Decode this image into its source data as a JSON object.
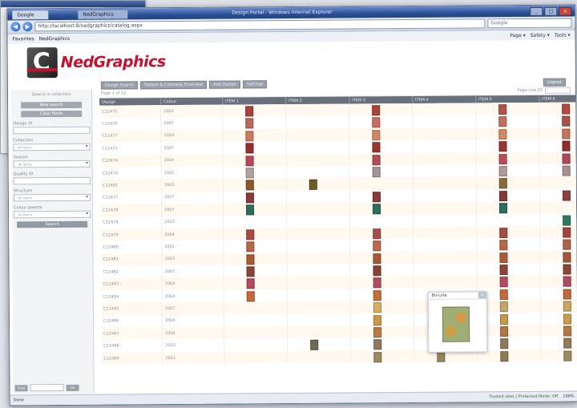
{
  "browser": {
    "tabs": [
      "Google",
      "NedGraphics"
    ],
    "window_title": "Design Portal - Windows Internet Explorer",
    "address": "http://localhost:8/nedgraphics/catalog.aspx",
    "search_placeholder": "Google",
    "favorites_label": "Favorites",
    "fav_item": "NedGraphics",
    "toolbar_right": [
      "Page ▾",
      "Safety ▾",
      "Tools ▾"
    ],
    "window_controls": [
      "_",
      "□",
      "×"
    ]
  },
  "app": {
    "logo_letter": "C",
    "brand": "NedGraphics",
    "brand_color": "#c8102e",
    "top_tabs": [
      "Design Search",
      "Pattern & Colorway Overview",
      "Add Design",
      "Settings"
    ],
    "top_tab_right": "Logout"
  },
  "sidebar": {
    "title": "Search in collection",
    "buttons": [
      "New search",
      "Clear fields"
    ],
    "fields": [
      {
        "label": "Design ID",
        "type": "input"
      },
      {
        "label": "Collection",
        "type": "select",
        "value": "- All items -"
      },
      {
        "label": "Season",
        "type": "select",
        "value": "- All items -"
      },
      {
        "label": "Quality ID",
        "type": "input"
      },
      {
        "label": "Structure",
        "type": "select",
        "value": "- All items -"
      },
      {
        "label": "Colour palette",
        "type": "select",
        "value": "- All items -"
      }
    ],
    "search_button": "Search",
    "bottom_left": "Save",
    "bottom_right": "Go"
  },
  "grid": {
    "toolbar_left": "Page 1 of 12",
    "toolbar_mid": "Page size 25",
    "columns": [
      "Design",
      "Colour",
      "ITEM 1",
      "ITEM 2",
      "ITEM 3",
      "ITEM 4",
      "ITEM 5",
      "ITEM 6"
    ],
    "rows": [
      {
        "design": "C12475",
        "colour": "2003",
        "sw": [
          [
            "#a8423a",
            0
          ],
          [
            "#a8423a",
            2
          ],
          [
            "#b0534a",
            4
          ],
          [
            "#b04a42",
            5
          ]
        ]
      },
      {
        "design": "C12476",
        "colour": "2007",
        "sw": [
          [
            "#b86a58",
            0
          ],
          [
            "#c47060",
            2
          ],
          [
            "#c0705e",
            4
          ],
          [
            "#a8504a",
            5
          ]
        ]
      },
      {
        "design": "C12477",
        "colour": "2003",
        "sw": [
          [
            "#cc7a5a",
            0
          ],
          [
            "#cf8a64",
            2
          ],
          [
            "#d08a62",
            4
          ],
          [
            "#c4735c",
            5
          ]
        ]
      },
      {
        "design": "C12471",
        "colour": "2007",
        "sw": [
          [
            "#93302c",
            0
          ],
          [
            "#9a3632",
            2
          ],
          [
            "#9a3632",
            4
          ],
          [
            "#8d2e2a",
            5
          ]
        ]
      },
      {
        "design": "C12474",
        "colour": "2004",
        "sw": [
          [
            "#b74a56",
            0
          ],
          [
            "#b44c58",
            2
          ],
          [
            "#b84e5a",
            4
          ],
          [
            "#b04858",
            5
          ]
        ]
      },
      {
        "design": "C12470",
        "colour": "2001",
        "sw": [
          [
            "#b3a2a2",
            0
          ],
          [
            "#a89494",
            2
          ],
          [
            "#ae9a98",
            4
          ],
          [
            "#a89090",
            5
          ]
        ]
      },
      {
        "design": "C12481",
        "colour": "2003",
        "sw": [
          [
            "#8a5a2e",
            0
          ],
          [
            "#6c5a2c",
            1
          ],
          [
            "#8a6a3a",
            4
          ]
        ]
      },
      {
        "design": "C12477",
        "colour": "2007",
        "sw": [
          [
            "#8a3a3a",
            0
          ],
          [
            "#8a3a3a",
            2
          ],
          [
            "#843838",
            4
          ],
          [
            "#8e4040",
            5
          ]
        ]
      },
      {
        "design": "C12478",
        "colour": "2007",
        "sw": [
          [
            "#2a6e5e",
            0
          ],
          [
            "#2a6e5e",
            2
          ],
          [
            "#2a6e5e",
            4
          ]
        ]
      },
      {
        "design": "C12478",
        "colour": "2003",
        "sw": [
          [
            "#2e7a5a",
            5
          ]
        ]
      },
      {
        "design": "C12479",
        "colour": "2004",
        "sw": [
          [
            "#a84a44",
            0
          ],
          [
            "#a84e46",
            2
          ],
          [
            "#a64a44",
            4
          ],
          [
            "#a24440",
            5
          ]
        ]
      },
      {
        "design": "C12480",
        "colour": "2001",
        "sw": [
          [
            "#b8664a",
            0
          ],
          [
            "#b86a4a",
            2
          ],
          [
            "#b8684a",
            4
          ],
          [
            "#b06248",
            5
          ]
        ]
      },
      {
        "design": "C12481",
        "colour": "2003",
        "sw": [
          [
            "#a85a34",
            0
          ],
          [
            "#a45a36",
            2
          ],
          [
            "#a85c38",
            4
          ],
          [
            "#a45838",
            5
          ]
        ]
      },
      {
        "design": "C12482",
        "colour": "2007",
        "sw": [
          [
            "#8a4438",
            0
          ],
          [
            "#8a4236",
            2
          ],
          [
            "#8c4438",
            4
          ],
          [
            "#8c4438",
            5
          ]
        ]
      },
      {
        "design": "C12483",
        "colour": "2004",
        "sw": [
          [
            "#b44a62",
            0
          ],
          [
            "#b44c62",
            2
          ],
          [
            "#b64a62",
            4
          ],
          [
            "#b24862",
            5
          ]
        ]
      },
      {
        "design": "C12484",
        "colour": "2004",
        "sw": [
          [
            "#c46a3a",
            0
          ],
          [
            "#c46e3a",
            2
          ],
          [
            "#c46a3a",
            4
          ],
          [
            "#c06a3a",
            5
          ]
        ]
      },
      {
        "design": "C12485",
        "colour": "2007",
        "sw": [
          [
            "#d4b060",
            2
          ],
          [
            "#c9a070",
            3
          ],
          [
            "#c4a86a",
            4
          ],
          [
            "#c9a468",
            5
          ]
        ]
      },
      {
        "design": "C12486",
        "colour": "2004",
        "sw": [
          [
            "#c89848",
            2
          ],
          [
            "#d4a050",
            3
          ],
          [
            "#c8984a",
            4
          ],
          [
            "#cc9a4a",
            5
          ]
        ]
      },
      {
        "design": "C12487",
        "colour": "2004",
        "sw": [
          [
            "#b87a48",
            2
          ],
          [
            "#b07444",
            3
          ],
          [
            "#b27648",
            4
          ],
          [
            "#b47848",
            5
          ]
        ]
      },
      {
        "design": "C12488",
        "colour": "2003",
        "sw": [
          [
            "#6e6a54",
            1
          ],
          [
            "#8e7a5a",
            2
          ],
          [
            "#9a8058",
            3
          ],
          [
            "#907a5c",
            4
          ],
          [
            "#947c5a",
            5
          ]
        ]
      },
      {
        "design": "C12489",
        "colour": "2001",
        "sw": [
          [
            "#9c8a60",
            2
          ],
          [
            "#988660",
            3
          ],
          [
            "#8e7c58",
            4
          ],
          [
            "#9a8a62",
            5
          ]
        ]
      }
    ]
  },
  "popup": {
    "title": "Bo-Lola",
    "close": "x"
  },
  "status": {
    "left": "Done",
    "zone": "Trusted sites | Protected Mode: Off",
    "zoom": "100%"
  }
}
